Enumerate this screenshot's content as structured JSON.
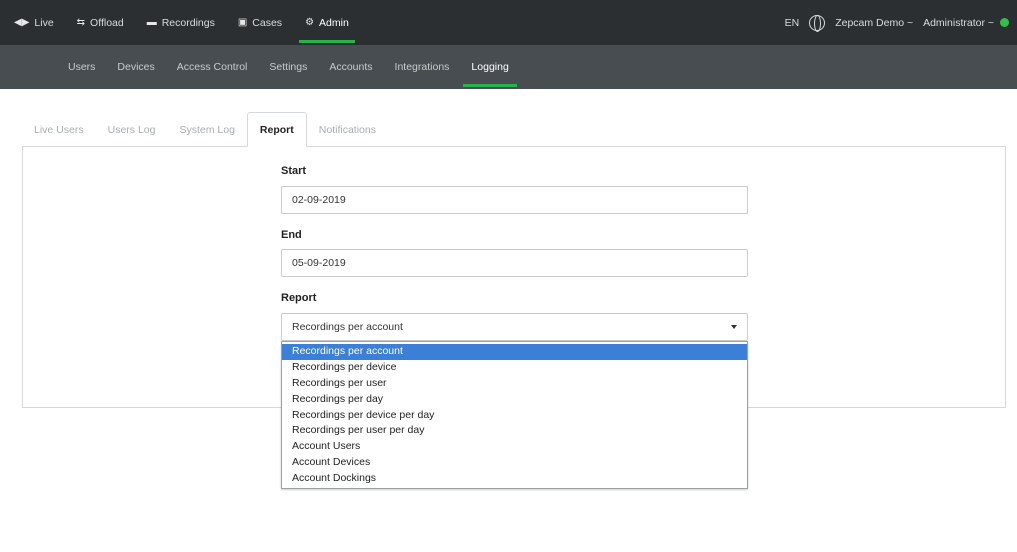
{
  "topnav": {
    "items": [
      {
        "label": "Live",
        "icon": "live-icon"
      },
      {
        "label": "Offload",
        "icon": "offload-icon"
      },
      {
        "label": "Recordings",
        "icon": "recordings-icon"
      },
      {
        "label": "Cases",
        "icon": "cases-icon"
      },
      {
        "label": "Admin",
        "icon": "gear-icon",
        "active": true
      }
    ],
    "language": "EN",
    "tenant": "Zepcam Demo ~",
    "user": "Administrator ~"
  },
  "subnav": {
    "items": [
      "Users",
      "Devices",
      "Access Control",
      "Settings",
      "Accounts",
      "Integrations",
      "Logging"
    ],
    "active": "Logging"
  },
  "tabs": {
    "items": [
      "Live Users",
      "Users Log",
      "System Log",
      "Report",
      "Notifications"
    ],
    "active": "Report"
  },
  "form": {
    "start_label": "Start",
    "start_value": "02-09-2019",
    "end_label": "End",
    "end_value": "05-09-2019",
    "report_label": "Report",
    "report_value": "Recordings per account"
  },
  "dropdown": {
    "options": [
      "Recordings per account",
      "Recordings per device",
      "Recordings per user",
      "Recordings per day",
      "Recordings per device per day",
      "Recordings per user per day",
      "Account Users",
      "Account Devices",
      "Account Dockings"
    ],
    "selected_index": 0
  },
  "colors": {
    "accent": "#28b44a",
    "topbar": "#2b2f32",
    "subbar": "#474d51",
    "selection": "#3b7fd6"
  }
}
